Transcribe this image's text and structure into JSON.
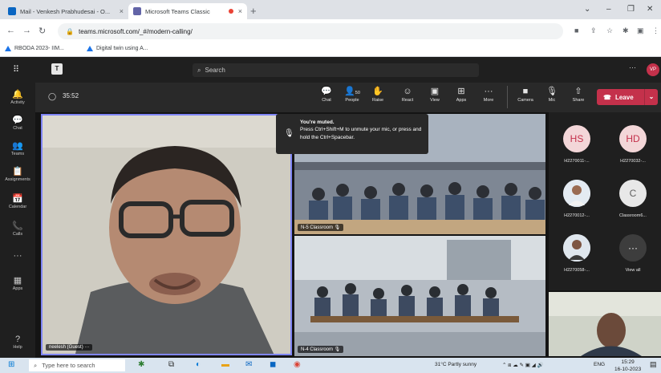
{
  "browser": {
    "tabs": [
      {
        "title": "Mail - Venkesh Prabhudesai - O...",
        "close": "×"
      },
      {
        "title": "Microsoft Teams Classic",
        "close": "×"
      }
    ],
    "new_tab": "+",
    "window_controls": [
      "⌄",
      "–",
      "❐",
      "✕"
    ],
    "url": "teams.microsoft.com/_#/modern-calling/",
    "bookmarks": [
      {
        "label": "RBODA 2023- IIM..."
      },
      {
        "label": "Digital twin using A..."
      }
    ]
  },
  "teams": {
    "search_placeholder": "Search",
    "more": "···",
    "avatar_initials": "VP",
    "rail": [
      {
        "label": "Activity",
        "icon": "bell-icon",
        "glyph": "🔔"
      },
      {
        "label": "Chat",
        "icon": "chat-icon",
        "glyph": "💬"
      },
      {
        "label": "Teams",
        "icon": "teams-icon",
        "glyph": "👥"
      },
      {
        "label": "Assignments",
        "icon": "assignments-icon",
        "glyph": "📋"
      },
      {
        "label": "Calendar",
        "icon": "calendar-icon",
        "glyph": "📅"
      },
      {
        "label": "Calls",
        "icon": "phone-icon",
        "glyph": "📞"
      },
      {
        "label": "",
        "icon": "more-icon",
        "glyph": "···"
      },
      {
        "label": "Apps",
        "icon": "apps-icon",
        "glyph": "▦"
      },
      {
        "label": "Help",
        "icon": "help-icon",
        "glyph": "?"
      }
    ],
    "meeting": {
      "timer": "35:52",
      "controls": [
        {
          "label": "Chat",
          "icon": "chat-icon",
          "glyph": "💬"
        },
        {
          "label": "People",
          "icon": "people-icon",
          "glyph": "👤",
          "badge": "50"
        },
        {
          "label": "Raise",
          "icon": "hand-icon",
          "glyph": "✋"
        },
        {
          "label": "React",
          "icon": "react-icon",
          "glyph": "☺"
        },
        {
          "label": "View",
          "icon": "view-icon",
          "glyph": "▣"
        },
        {
          "label": "Apps",
          "icon": "apps-icon",
          "glyph": "⊞"
        },
        {
          "label": "More",
          "icon": "more-icon",
          "glyph": "···"
        },
        {
          "label": "Camera",
          "icon": "camera-icon",
          "glyph": "■"
        },
        {
          "label": "Mic",
          "icon": "mic-off-icon",
          "glyph": "🎙"
        },
        {
          "label": "Share",
          "icon": "share-icon",
          "glyph": "⇧"
        }
      ],
      "leave_label": "Leave"
    },
    "toast": {
      "title": "You're muted.",
      "body": "Press Ctrl+Shift+M to unmute your mic, or press and hold the Ctrl+Spacebar."
    },
    "tiles": {
      "main_name": "neelesh (Guest)",
      "room1": "N-5 Classroom",
      "room2": "N-4 Classroom"
    },
    "roster": [
      {
        "initials": "HS",
        "name": "H2270011-...",
        "color": "#f3d6d8",
        "text": "#c4314b"
      },
      {
        "initials": "HD",
        "name": "H2270032-...",
        "color": "#f3d6d8",
        "text": "#c4314b"
      },
      {
        "initials": "",
        "name": "H2270012-...",
        "color": "#d8e0ea",
        "text": "#444"
      },
      {
        "initials": "C",
        "name": "Classroom6...",
        "color": "#e8e8e8",
        "text": "#616161"
      },
      {
        "initials": "",
        "name": "H2270058-...",
        "color": "#d8e0ea",
        "text": "#444"
      },
      {
        "initials": "···",
        "name": "View all",
        "color": "#3d3d3d",
        "text": "#fff"
      }
    ]
  },
  "taskbar": {
    "search_placeholder": "Type here to search",
    "weather": "31°C  Partly sunny",
    "lang": "ENG",
    "time": "15:29",
    "date": "16-10-2023"
  },
  "colors": {
    "teams_bg": "#1f1f1f",
    "leave": "#c4314b",
    "accent": "#6264a7"
  }
}
